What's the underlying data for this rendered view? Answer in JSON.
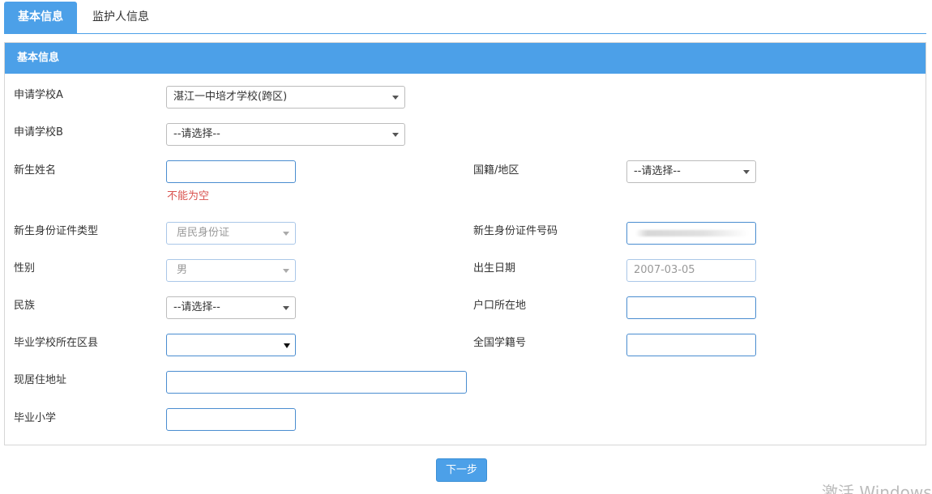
{
  "tabs": [
    {
      "label": "基本信息",
      "active": true
    },
    {
      "label": "监护人信息",
      "active": false
    }
  ],
  "panel": {
    "title": "基本信息"
  },
  "form": {
    "school_a": {
      "label": "申请学校A",
      "value": "湛江一中培才学校(跨区)"
    },
    "school_b": {
      "label": "申请学校B",
      "value": "--请选择--"
    },
    "student_name": {
      "label": "新生姓名",
      "value": "",
      "error": "不能为空"
    },
    "nationality": {
      "label": "国籍/地区",
      "value": "--请选择--"
    },
    "id_type": {
      "label": "新生身份证件类型",
      "value": "居民身份证"
    },
    "id_number": {
      "label": "新生身份证件号码",
      "value": ""
    },
    "gender": {
      "label": "性别",
      "value": "男"
    },
    "birth_date": {
      "label": "出生日期",
      "value": "2007-03-05"
    },
    "ethnicity": {
      "label": "民族",
      "value": "--请选择--"
    },
    "household": {
      "label": "户口所在地",
      "value": ""
    },
    "grad_district": {
      "label": "毕业学校所在区县",
      "value": ""
    },
    "student_no": {
      "label": "全国学籍号",
      "value": ""
    },
    "address": {
      "label": "现居住地址",
      "value": ""
    },
    "primary_school": {
      "label": "毕业小学",
      "value": ""
    }
  },
  "buttons": {
    "next": "下一步"
  },
  "watermark": "激活 Windows"
}
